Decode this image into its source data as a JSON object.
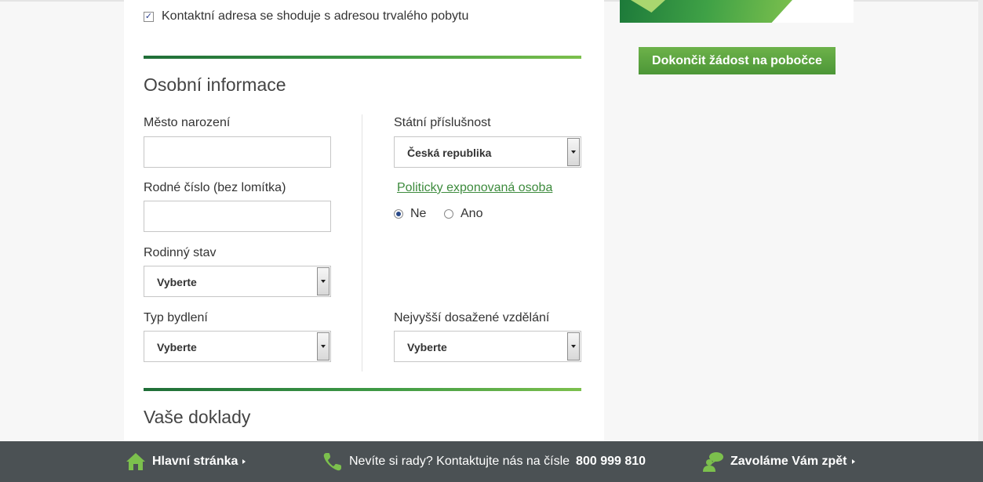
{
  "form": {
    "contact_checkbox_label": "Kontaktní adresa se shoduje s adresou trvalého pobytu",
    "contact_checkbox_checked": true,
    "personal_title": "Osobní informace",
    "birthplace_label": "Město narození",
    "birthplace_value": "",
    "birth_number_label": "Rodné číslo (bez lomítka)",
    "birth_number_value": "",
    "marital_label": "Rodinný stav",
    "marital_value": "Vyberte",
    "housing_label": "Typ bydlení",
    "housing_value": "Vyberte",
    "citizenship_label": "Státní příslušnost",
    "citizenship_value": "Česká republika",
    "pep_link": "Politicky exponovaná osoba",
    "pep_options": [
      {
        "label": "Ne",
        "checked": true
      },
      {
        "label": "Ano",
        "checked": false
      }
    ],
    "education_label": "Nejvyšší dosažené vzdělání",
    "education_value": "Vyberte",
    "documents_title": "Vaše doklady"
  },
  "sidebar": {
    "cta_label": "Dokončit žádost na pobočce"
  },
  "footer": {
    "home_label": "Hlavní stránka",
    "help_text": "Nevíte si rady? Kontaktujte nás na čísle",
    "phone": "800 999 810",
    "callback_label": "Zavoláme Vám zpět"
  },
  "colors": {
    "accent_green": "#4c9637",
    "link_green": "#3d8b3d",
    "footer_bg": "#4b5154"
  }
}
